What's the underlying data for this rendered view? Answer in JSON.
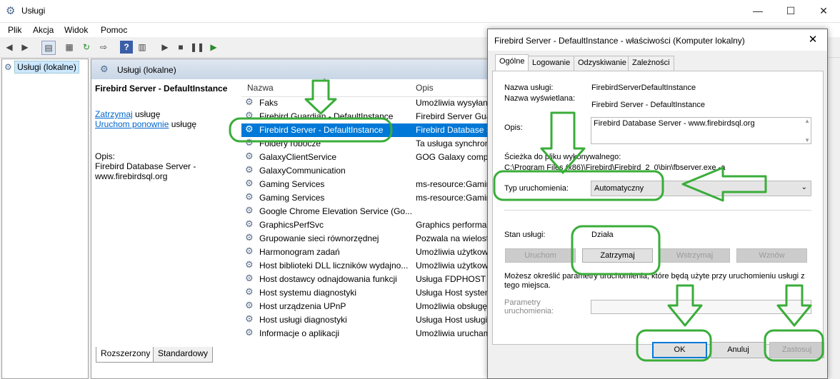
{
  "window": {
    "title": "Usługi",
    "min": "—",
    "max": "☐",
    "close": "✕"
  },
  "menu": [
    "Plik",
    "Akcja",
    "Widok",
    "Pomoc"
  ],
  "tree": {
    "root": "Usługi (lokalne)"
  },
  "pane": {
    "header": "Usługi (lokalne)",
    "selected_name": "Firebird Server - DefaultInstance",
    "stop_link": "Zatrzymaj",
    "stop_suffix": " usługę",
    "restart_link": "Uruchom ponownie",
    "restart_suffix": " usługę",
    "desc_label": "Opis:",
    "desc_text": "Firebird Database Server - www.firebirdsql.org"
  },
  "list": {
    "columns": {
      "name": "Nazwa",
      "desc": "Opis"
    },
    "rows": [
      {
        "name": "Faks",
        "desc": "Umożliwia wysyłanie"
      },
      {
        "name": "Firebird Guardian - DefaultInstance",
        "desc": "Firebird Server Guardian"
      },
      {
        "name": "Firebird Server - DefaultInstance",
        "desc": "Firebird Database Server"
      },
      {
        "name": "Foldery robocze",
        "desc": "Ta usługa synchronizuje"
      },
      {
        "name": "GalaxyClientService",
        "desc": "GOG Galaxy component"
      },
      {
        "name": "GalaxyCommunication",
        "desc": ""
      },
      {
        "name": "Gaming Services",
        "desc": "ms-resource:Gaming"
      },
      {
        "name": "Gaming Services",
        "desc": "ms-resource:Gaming"
      },
      {
        "name": "Google Chrome Elevation Service (Go...",
        "desc": ""
      },
      {
        "name": "GraphicsPerfSvc",
        "desc": "Graphics performance"
      },
      {
        "name": "Grupowanie sieci równorzędnej",
        "desc": "Pozwala na wielostronną"
      },
      {
        "name": "Harmonogram zadań",
        "desc": "Umożliwia użytkownikowi"
      },
      {
        "name": "Host biblioteki DLL liczników wydajno...",
        "desc": "Umożliwia użytkownikom"
      },
      {
        "name": "Host dostawcy odnajdowania funkcji",
        "desc": "Usługa FDPHOST"
      },
      {
        "name": "Host systemu diagnostyki",
        "desc": "Usługa Host systemu"
      },
      {
        "name": "Host urządzenia UPnP",
        "desc": "Umożliwia obsługę"
      },
      {
        "name": "Host usługi diagnostyki",
        "desc": "Usługa Host usługi"
      },
      {
        "name": "Informacje o aplikacji",
        "desc": "Umożliwia uruchamianie"
      }
    ]
  },
  "bottom_tabs": [
    "Rozszerzony",
    "Standardowy"
  ],
  "dialog": {
    "title": "Firebird Server - DefaultInstance - właściwości (Komputer lokalny)",
    "close": "✕",
    "tabs": [
      "Ogólne",
      "Logowanie",
      "Odzyskiwanie",
      "Zależności"
    ],
    "service_name_label": "Nazwa usługi:",
    "service_name": "FirebirdServerDefaultInstance",
    "display_name_label": "Nazwa wyświetlana:",
    "display_name": "Firebird Server - DefaultInstance",
    "desc_label": "Opis:",
    "desc": "Firebird Database Server - www.firebirdsql.org",
    "path_label": "Ścieżka do pliku wykonywalnego:",
    "path": "C:\\Program Files (x86)\\Firebird\\Firebird_2_0\\bin\\fbserver.exe -a",
    "startup_label": "Typ uruchomienia:",
    "startup_value": "Automatyczny",
    "status_label": "Stan usługi:",
    "status_value": "Działa",
    "btn_start": "Uruchom",
    "btn_stop": "Zatrzymaj",
    "btn_pause": "Wstrzymaj",
    "btn_resume": "Wznów",
    "params_hint": "Możesz określić parametry uruchomienia, które będą użyte przy uruchomieniu usługi z tego miejsca.",
    "params_label": "Parametry uruchomienia:",
    "ok": "OK",
    "cancel": "Anuluj",
    "apply": "Zastosuj"
  },
  "colors": {
    "accent": "#0078d7",
    "annotation": "#3aad3a"
  }
}
